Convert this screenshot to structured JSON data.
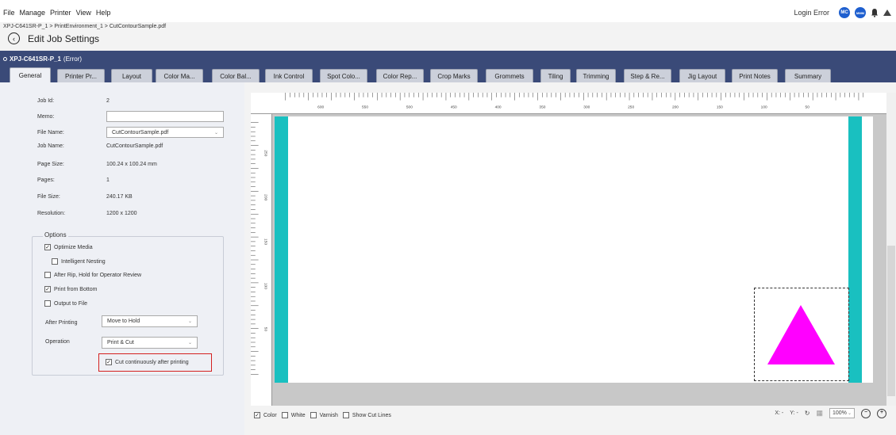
{
  "menu": [
    "File",
    "Manage",
    "Printer",
    "View",
    "Help"
  ],
  "header": {
    "login_status": "Login Error",
    "avatar1": "MC",
    "avatar2": "MMM"
  },
  "breadcrumb": "XPJ-C641SR-P_1 > PrintEnvironment_1 > CutContourSample.pdf",
  "page_title": "Edit Job Settings",
  "printer": {
    "name": "XPJ-C641SR-P_1",
    "status": "(Error)"
  },
  "tabs": [
    "General",
    "Printer Pr...",
    "Layout",
    "Color Ma...",
    "Color Bal...",
    "Ink Control",
    "Spot Colo...",
    "Color Rep...",
    "Crop Marks",
    "Grommets",
    "Tiling",
    "Trimming",
    "Step & Re...",
    "Jig Layout",
    "Print Notes",
    "Summary"
  ],
  "job": {
    "job_id_label": "Job Id:",
    "job_id": "2",
    "memo_label": "Memo:",
    "file_name_label": "File Name:",
    "file_name": "CutContourSample.pdf",
    "job_name_label": "Job Name:",
    "job_name": "CutContourSample.pdf",
    "page_size_label": "Page Size:",
    "page_size": "100.24  x 100.24 mm",
    "pages_label": "Pages:",
    "pages": "1",
    "file_size_label": "File Size:",
    "file_size": "240.17 KB",
    "resolution_label": "Resolution:",
    "resolution": "1200 x 1200"
  },
  "options": {
    "title": "Options",
    "optimize_media": "Optimize Media",
    "intelligent_nesting": "Intelligent Nesting",
    "after_rip_hold": "After Rip, Hold for Operator Review",
    "print_from_bottom": "Print from Bottom",
    "output_to_file": "Output to File",
    "after_printing_label": "After Printing",
    "after_printing_value": "Move to Hold",
    "operation_label": "Operation",
    "operation_value": "Print & Cut",
    "cut_continuously": "Cut continuously after printing"
  },
  "ruler": {
    "top": [
      "600",
      "550",
      "500",
      "450",
      "400",
      "350",
      "300",
      "250",
      "200",
      "150",
      "100",
      "50"
    ],
    "left": [
      "250",
      "200",
      "150",
      "100",
      "50"
    ]
  },
  "bottom": {
    "color": "Color",
    "white": "White",
    "varnish": "Varnish",
    "show_cut_lines": "Show Cut Lines",
    "x_label": "X: -",
    "y_label": "Y: -",
    "zoom": "100%"
  },
  "colors": {
    "accent_bar": "#3a4a78",
    "media_edge": "#19c0c0",
    "shape": "#ff00ff",
    "highlight": "#d42020"
  }
}
